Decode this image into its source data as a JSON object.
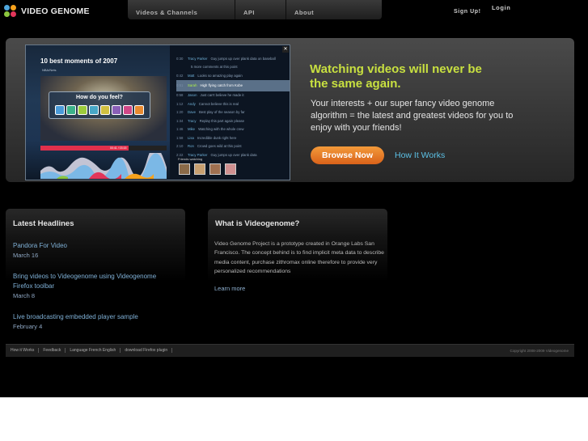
{
  "header": {
    "logo_text": "VIDEO GENOME",
    "nav": [
      "Videos & Channels",
      "API",
      "About"
    ],
    "signup": "Sign Up!",
    "login": "Login"
  },
  "hero": {
    "screenshot": {
      "title": "10 best moments of 2007",
      "source": "NBA/Nets",
      "prompt": "How do you feel?",
      "timecode": "00:41 / 03:15",
      "progress_fraction": 0.7,
      "friends_label": "Friends watching",
      "highlight": "High flying catch from Kobe",
      "rows": [
        {
          "time": "0:30",
          "name": "Tracy Parker",
          "text": "Guy jumps up over plank data on baseball"
        },
        {
          "time": "",
          "name": "",
          "text": "5 more comments at this point"
        },
        {
          "time": "0:42",
          "name": "Matt",
          "text": "Looks so amazing play again"
        },
        {
          "time": "0:51",
          "name": "Sarah",
          "text": "High flying catch from Kobe"
        },
        {
          "time": "0:58",
          "name": "Jason",
          "text": "Just can't believe he made it"
        },
        {
          "time": "1:12",
          "name": "Andy",
          "text": "Cannot believe this is real"
        },
        {
          "time": "1:20",
          "name": "Dave",
          "text": "Best play of the season by far"
        },
        {
          "time": "1:34",
          "name": "Tracy",
          "text": "Replay this part again please"
        },
        {
          "time": "1:46",
          "name": "Mike",
          "text": "Watching with the whole crew"
        },
        {
          "time": "1:58",
          "name": "Lisa",
          "text": "Incredible dunk right here"
        },
        {
          "time": "2:10",
          "name": "Ron",
          "text": "Crowd goes wild at this point"
        },
        {
          "time": "2:22",
          "name": "Tracy Parker",
          "text": "Guy jumps up over plank data"
        }
      ]
    },
    "headline": "Watching videos will never be the same again.",
    "body": "Your interests + our super fancy video genome algorithm = the latest and greatest videos for you to enjoy with your friends!",
    "browse_button": "Browse Now",
    "how_link": "How It Works"
  },
  "news": {
    "title": "Latest Headlines",
    "items": [
      {
        "title": "Pandora For Video",
        "date": "March 16"
      },
      {
        "title": "Bring videos to Videogenome using Videogenome Firefox toolbar",
        "date": "March 8"
      },
      {
        "title": "Live broadcasting embedded player sample",
        "date": "February 4"
      }
    ]
  },
  "about": {
    "title": "What is Videogenome?",
    "text": "Video Genome Project is a prototype created in Orange Labs San Francisco. The concept behind is to find implicit meta data to describe media content, purchase zithromax online therefore to provide very personalized recommendations",
    "learn_more": "Learn more"
  },
  "footer": {
    "links": [
      "How it Works",
      "Feedback",
      "Language French English",
      "download Firefox plugin"
    ],
    "copyright": "Copyright 2008-2009 Videogenome"
  },
  "colors": {
    "accent_green": "#c8e040",
    "link_blue": "#5cc1e6",
    "button_orange": "#e07a2a"
  }
}
